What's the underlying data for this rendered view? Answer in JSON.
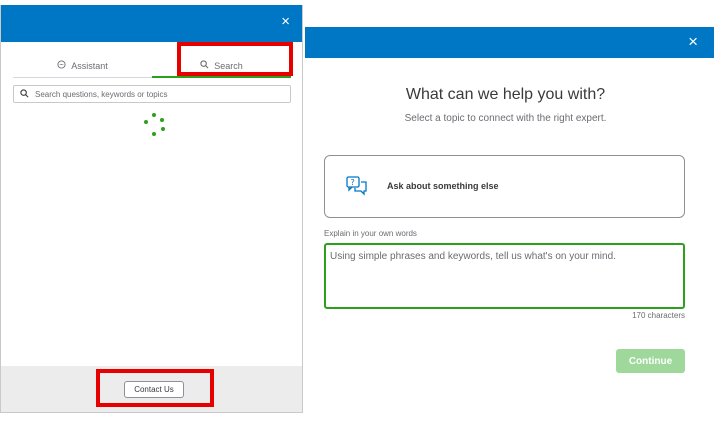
{
  "left_panel": {
    "close_glyph": "×",
    "tabs": [
      {
        "label": "Assistant",
        "icon": "chat-bubble-icon",
        "active": false
      },
      {
        "label": "Search",
        "icon": "search-icon",
        "active": true
      }
    ],
    "search": {
      "placeholder": "Search questions, keywords or topics"
    },
    "loading": true,
    "footer": {
      "contact_label": "Contact Us"
    }
  },
  "right_panel": {
    "close_glyph": "×",
    "heading": "What can we help you with?",
    "subheading": "Select a topic to connect with the right expert.",
    "topic": {
      "label": "Ask about something else",
      "icon": "question-chat-icon"
    },
    "explain": {
      "label": "Explain in your own words",
      "placeholder": "Using simple phrases and keywords, tell us what's on your mind."
    },
    "char_count": "170 characters",
    "continue_label": "Continue"
  },
  "colors": {
    "header_blue": "#0077c5",
    "accent_green": "#2ca01c",
    "annotation_red": "#e60000",
    "disabled_green": "#9ed89a"
  }
}
